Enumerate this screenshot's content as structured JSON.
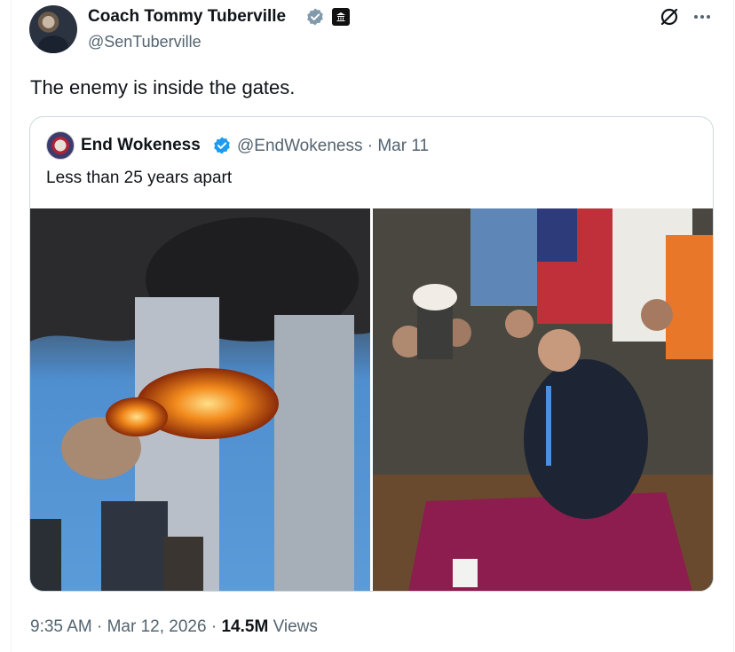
{
  "post": {
    "author_name": "Coach Tommy Tuberville",
    "author_handle": "@SenTuberville",
    "text": "The enemy is inside the gates.",
    "icons": {
      "verified": "verified-badge-icon",
      "government": "government-badge-icon",
      "grok": "grok-icon",
      "more": "more-options-icon"
    },
    "colors": {
      "verified_fill": "#829aab",
      "text": "#0f1419",
      "muted": "#536471",
      "border": "#cfd9de"
    }
  },
  "quote": {
    "author_name": "End Wokeness",
    "author_handle": "@EndWokeness",
    "separator": "·",
    "date": "Mar 11",
    "text": "Less than 25 years apart",
    "verified_color": "#1d9bf0",
    "media": [
      {
        "description": "World Trade Center towers on fire with explosion"
      },
      {
        "description": "Man in suit seated on rug in office with group, flags behind"
      }
    ]
  },
  "footer": {
    "time": "9:35 AM",
    "sep1": "·",
    "date": "Mar 12, 2026",
    "sep2": "·",
    "views_count": "14.5M",
    "views_label": "Views"
  }
}
